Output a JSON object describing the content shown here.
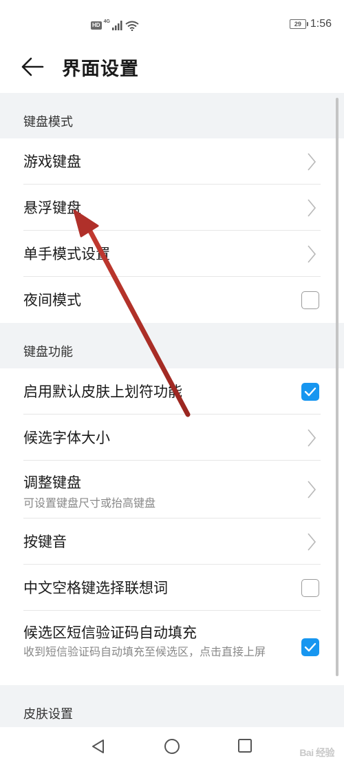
{
  "status_bar": {
    "hd": "HD",
    "network": "4G",
    "battery": "29",
    "time": "1:56"
  },
  "header": {
    "title": "界面设置"
  },
  "sections": [
    {
      "title": "键盘模式",
      "rows": [
        {
          "title": "游戏键盘",
          "control": "chevron"
        },
        {
          "title": "悬浮键盘",
          "control": "chevron"
        },
        {
          "title": "单手模式设置",
          "control": "chevron"
        },
        {
          "title": "夜间模式",
          "control": "checkbox",
          "checked": false
        }
      ]
    },
    {
      "title": "键盘功能",
      "rows": [
        {
          "title": "启用默认皮肤上划符功能",
          "control": "checkbox",
          "checked": true
        },
        {
          "title": "候选字体大小",
          "control": "chevron"
        },
        {
          "title": "调整键盘",
          "subtitle": "可设置键盘尺寸或抬高键盘",
          "control": "chevron"
        },
        {
          "title": "按键音",
          "control": "chevron"
        },
        {
          "title": "中文空格键选择联想词",
          "control": "checkbox",
          "checked": false
        },
        {
          "title": "候选区短信验证码自动填充",
          "subtitle": "收到短信验证码自动填充至候选区，点击直接上屏",
          "control": "checkbox",
          "checked": true
        }
      ]
    },
    {
      "title": "皮肤设置",
      "rows": []
    }
  ],
  "nav_bar": {
    "icons": [
      "back-triangle-icon",
      "home-circle-icon",
      "recents-square-icon"
    ]
  },
  "watermark": "Bai 经验",
  "colors": {
    "accent": "#1796f0",
    "background": "#f1f3f5",
    "annotation_arrow": "#b0302a"
  }
}
